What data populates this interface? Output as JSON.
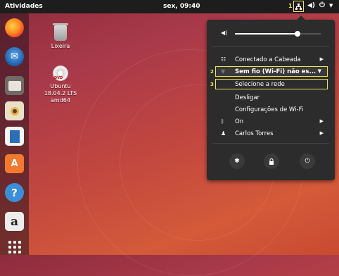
{
  "topbar": {
    "activities": "Atividades",
    "clock": "sex, 09:40",
    "step1": "1",
    "network_icon": "network-wired-icon",
    "volume_icon": "speaker-icon",
    "power_icon": "power-icon"
  },
  "dock": {
    "apps": [
      "Firefox",
      "Thunderbird",
      "Arquivos",
      "Rhythmbox",
      "LibreOffice Writer",
      "Ubuntu Software",
      "Ajuda",
      "Amazon",
      "Mostrar aplicativos"
    ],
    "amazon_glyph": "a",
    "help_glyph": "?"
  },
  "desktop": {
    "trash_label": "Lixeira",
    "dvd_label": "Ubuntu\n18.04.2 LTS\namd64",
    "dvd_text": "DVD"
  },
  "menu": {
    "volume_level": 0.73,
    "wired": "Conectado a Cabeada",
    "wifi": "Sem fio (Wi-Fi) não es...",
    "step2": "2",
    "select_network": "Selecione a rede",
    "step3": "3",
    "turn_off": "Desligar",
    "wifi_settings": "Configurações de Wi-Fi",
    "bluetooth": "On",
    "user": "Carlos Torres",
    "buttons": [
      "settings-icon",
      "lock-icon",
      "power-icon"
    ]
  },
  "colors": {
    "highlight": "#f2e35b",
    "menu_bg": "#2c2c2c",
    "topbar_bg": "#1d1d1d"
  }
}
